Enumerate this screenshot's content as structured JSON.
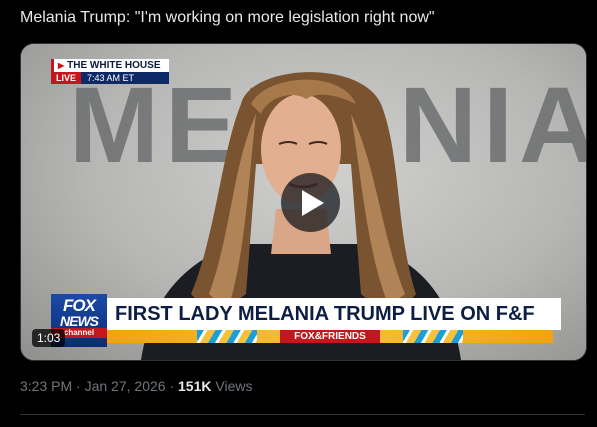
{
  "post": {
    "text": "Melania Trump: \"I'm working on more legislation right now\""
  },
  "video": {
    "background_word": "MELANIA",
    "corner_bug": {
      "network": "THE WHITE HOUSE",
      "live": "LIVE",
      "time": "7:43 AM ET"
    },
    "lower_third": {
      "logo_line1": "FOX",
      "logo_line2": "NEWS",
      "logo_line3": "channel",
      "headline": "FIRST LADY MELANIA TRUMP LIVE ON F&F",
      "show_name": "FOX&FRIENDS"
    },
    "duration": "1:03",
    "play_icon": "play-icon"
  },
  "meta": {
    "time": "3:23 PM",
    "separator1": "·",
    "date": "Jan 27, 2026",
    "separator2": "·",
    "views_count": "151K",
    "views_label": "Views"
  },
  "colors": {
    "fox_red": "#c4161c",
    "fox_blue": "#0d2a66",
    "muted_text": "#71767b"
  }
}
